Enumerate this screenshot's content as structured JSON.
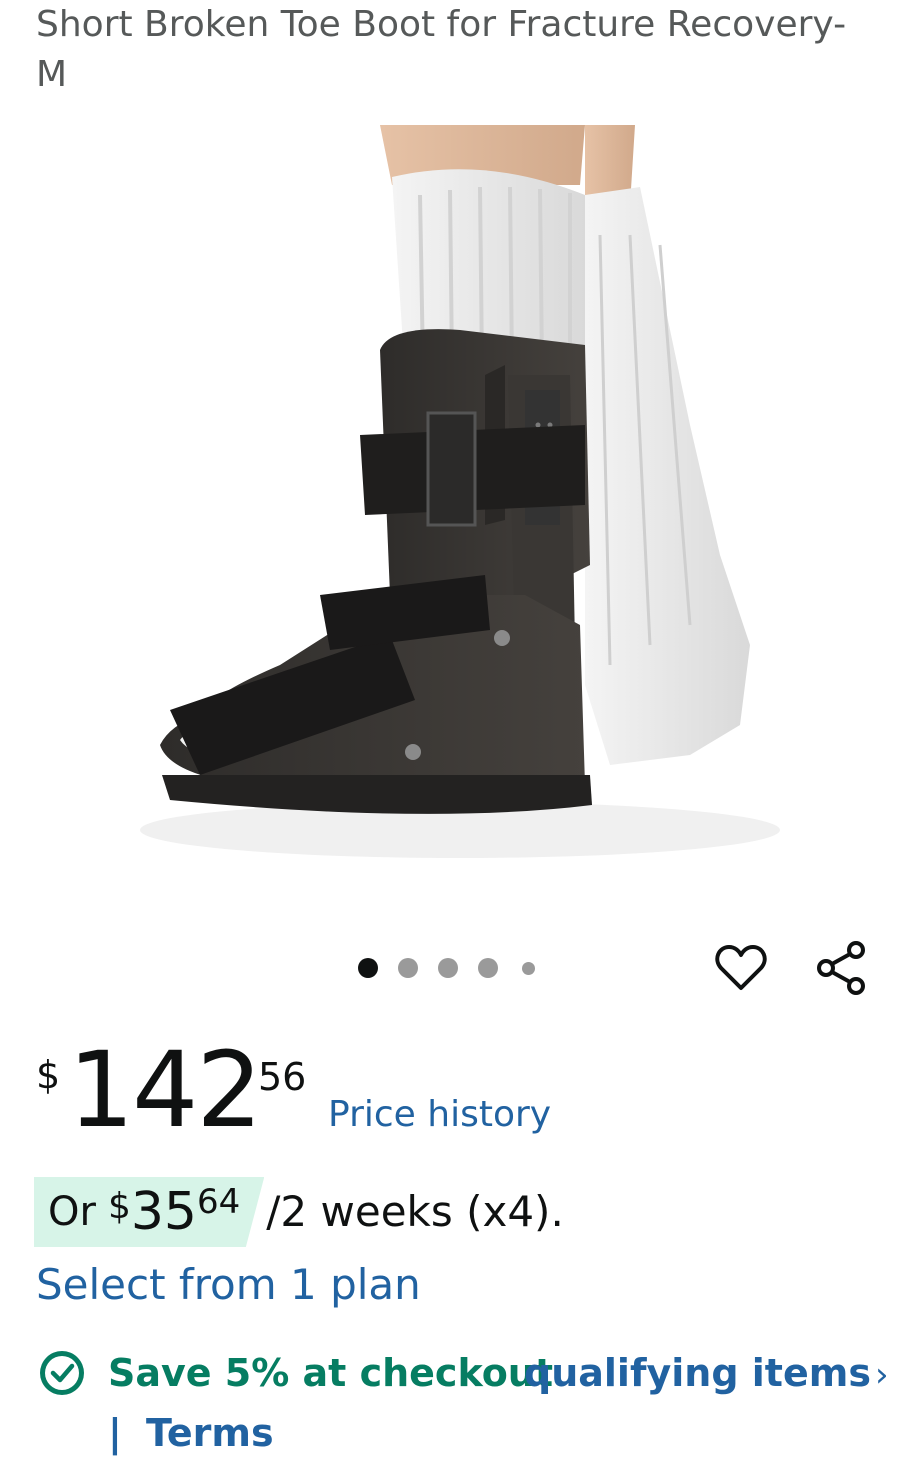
{
  "product": {
    "title": "Short Broken Toe Boot for Fracture Recovery- M",
    "image_alt": "Black short walking boot worn over white sock"
  },
  "gallery": {
    "dot_count": 5,
    "active_index": 0
  },
  "actions": {
    "wishlist_icon": "heart-icon",
    "share_icon": "share-icon"
  },
  "price": {
    "currency": "$",
    "whole": "142",
    "fraction": "56",
    "history_label": "Price history"
  },
  "installment": {
    "prefix": "Or",
    "currency": "$",
    "whole": "35",
    "fraction": "64",
    "suffix": "/2 weeks (x4).",
    "plan_link": "Select from 1 plan"
  },
  "promotion": {
    "icon": "check-circle-icon",
    "save_text": "Save 5% at checkout",
    "link_text": "qualifying items",
    "chevron": "›",
    "separator": "|",
    "terms_text": "Terms"
  },
  "colors": {
    "link": "#2162a1",
    "promo_green": "#067d62",
    "installment_bg": "#d7f4e8",
    "title_gray": "#565959"
  }
}
